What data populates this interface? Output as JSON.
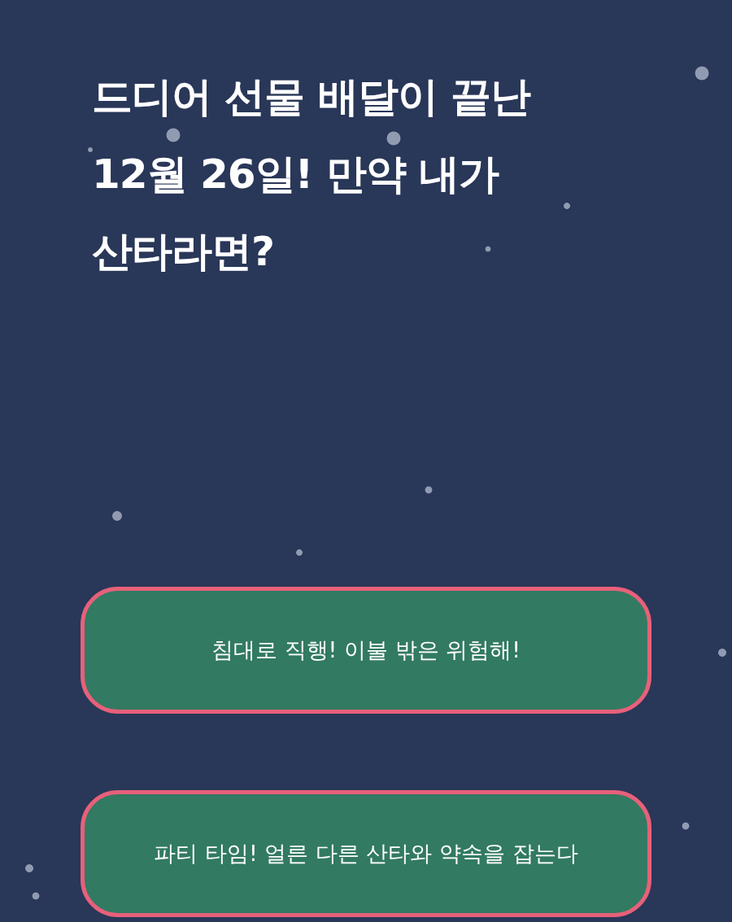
{
  "question": {
    "title": "드디어 선물 배달이 끝난\n12월 26일! 만약 내가\n산타라면?"
  },
  "choices": [
    {
      "label": "침대로 직행! 이불 밖은 위험해!"
    },
    {
      "label": "파티 타임! 얼른 다른 산타와 약속을 잡는다"
    }
  ]
}
